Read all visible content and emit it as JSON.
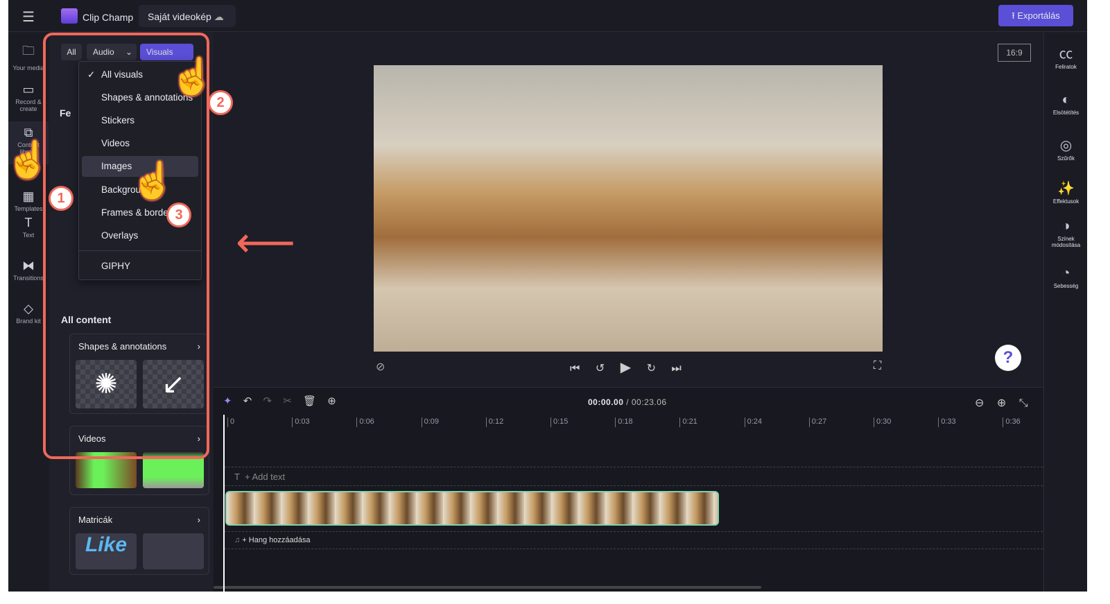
{
  "topbar": {
    "app_name": "Clip Champ",
    "project_title": "Saját videokép",
    "export_label": "Exportálás"
  },
  "nav": [
    {
      "label": "Your media",
      "icon": "folder-icon"
    },
    {
      "label": "Record & create",
      "icon": "camera-icon"
    },
    {
      "label": "Content library",
      "icon": "content-library-icon"
    },
    {
      "label": "Templates",
      "icon": "templates-icon"
    },
    {
      "label": "Text",
      "icon": "text-icon"
    },
    {
      "label": "Transitions",
      "icon": "transitions-icon"
    },
    {
      "label": "Brand kit",
      "icon": "brand-kit-icon"
    }
  ],
  "panel": {
    "filters": {
      "all": "All",
      "audio": "Audio",
      "visuals": "Visuals"
    },
    "featured_heading": "Fe",
    "all_content_heading": "All content",
    "cards": [
      {
        "title": "Shapes & annotations"
      },
      {
        "title": "Videos"
      },
      {
        "title": "Matricák"
      }
    ]
  },
  "dropdown": {
    "items": [
      "All visuals",
      "Shapes & annotations",
      "Stickers",
      "Videos",
      "Images",
      "Backgrounds",
      "Frames & borders",
      "Overlays"
    ],
    "extra": "GIPHY",
    "selected": "All visuals",
    "hovered": "Images"
  },
  "preview": {
    "aspect_ratio": "16:9"
  },
  "right": [
    {
      "label": "Feliratok",
      "icon": "captions-icon"
    },
    {
      "label": "Elsötétítés",
      "icon": "fade-icon"
    },
    {
      "label": "Szűrők",
      "icon": "filters-icon"
    },
    {
      "label": "Effektusok",
      "icon": "effects-icon"
    },
    {
      "label": "Színek módosítása",
      "icon": "color-adjust-icon"
    },
    {
      "label": "Sebesség",
      "icon": "speed-icon"
    }
  ],
  "timeline": {
    "current": "00:00.00",
    "total": "/ 00:23.06",
    "ticks": [
      "0",
      "0:03",
      "0:06",
      "0:09",
      "0:12",
      "0:15",
      "0:18",
      "0:21",
      "0:24",
      "0:27",
      "0:30",
      "0:33",
      "0:36"
    ],
    "add_text": "+ Add text",
    "add_audio": "Hang hozzáadása"
  },
  "annotations": {
    "steps": [
      "1",
      "2",
      "3"
    ]
  },
  "colors": {
    "accent": "#5a4fd6",
    "annotation": "#f0685a",
    "clip_border": "#7fd3b0"
  }
}
